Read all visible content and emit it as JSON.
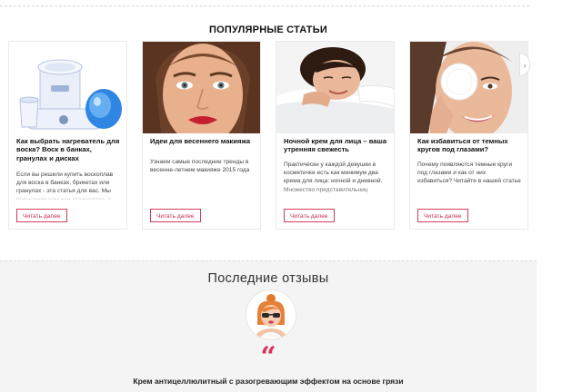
{
  "popular": {
    "title": "ПОПУЛЯРНЫЕ СТАТЬИ",
    "cards": [
      {
        "title": "Как выбрать нагреватель для воска? Воск в банках, гранулах и дисках",
        "desc": "Если вы решили купить воскоплав для воска в банках, брикетах или гранулах - эта статья для вас. Мы расскажем чем они отличаются, в чем плюсы и минусы разных",
        "button": "Читать далее",
        "image_icon": "wax-heater-image"
      },
      {
        "title": "Идеи для весеннего макияжа",
        "desc": "Узнаем самые последние тренды в весенне-летнем макияже 2015 года",
        "button": "Читать далее",
        "image_icon": "spring-makeup-face-image"
      },
      {
        "title": "Ночной крем для лица – ваша утренняя свежесть",
        "desc": "Практически у каждой девушки в косметичке есть как минимум два крема для лица: ночной и дневной. Множество представительниц прекрасного пола считают, что",
        "button": "Читать далее",
        "image_icon": "sleeping-woman-image"
      },
      {
        "title": "Как избавиться от темных кругов под глазами?",
        "desc": "Почему появляются темные круги под глазами и как от них избавиться? Читайте в нашей статье",
        "button": "Читать далее",
        "image_icon": "cotton-pad-eye-image"
      }
    ]
  },
  "reviews": {
    "title": "Последние отзывы",
    "quote_symbol": "“",
    "product": "Крем антицеллюлитный с разогревающим эффектом на основе грязи"
  },
  "colors": {
    "accent": "#d8315b",
    "reviews_bg": "#f4f4f4"
  }
}
